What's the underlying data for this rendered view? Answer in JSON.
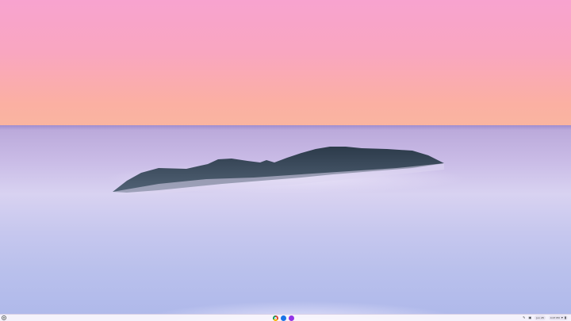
{
  "shelf": {
    "apps": [
      {
        "name": "chrome-icon"
      },
      {
        "name": "files-icon"
      },
      {
        "name": "play-store-icon"
      }
    ],
    "tray": {
      "date": "Jun 28",
      "time": "4:07 PM",
      "icons": [
        "pen-icon",
        "screen-capture-icon",
        "notification-icon",
        "wifi-icon",
        "battery-icon"
      ]
    }
  },
  "colors": {
    "sky_top": "#f8a3cf",
    "sky_bottom": "#f9b6a0",
    "sea": "#c6c7ee",
    "island": "#2c3d4a"
  }
}
